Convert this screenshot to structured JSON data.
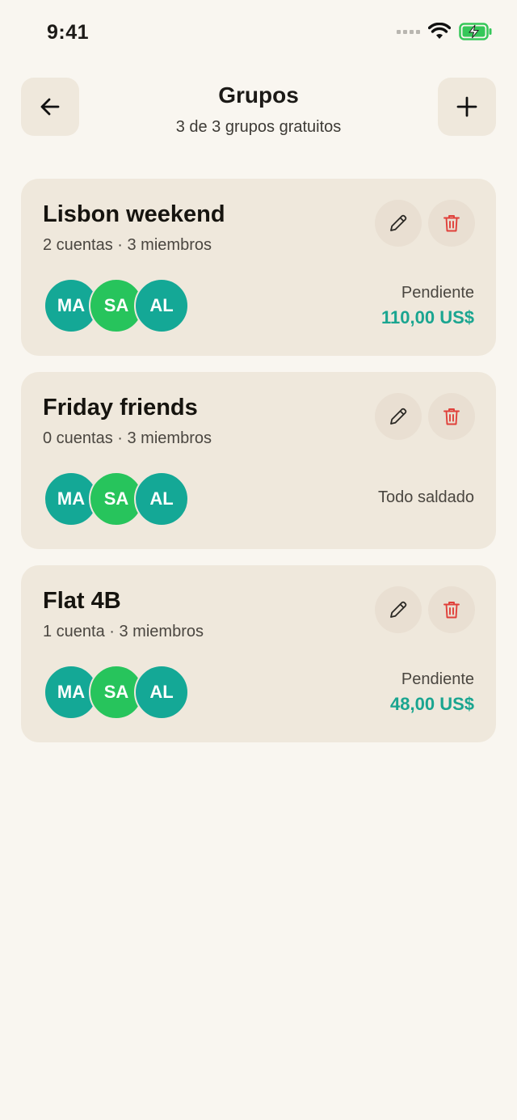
{
  "status_bar": {
    "time": "9:41"
  },
  "header": {
    "title": "Grupos",
    "subtitle": "3 de 3 grupos gratuitos"
  },
  "colors": {
    "background": "#f9f6f0",
    "card": "#efe8dc",
    "accent_teal": "#1aa590",
    "avatar_teal": "#14a896",
    "avatar_green": "#27c45c",
    "delete_red": "#e0403a",
    "battery_green": "#35c759"
  },
  "icons": {
    "back": "arrow-left-icon",
    "add": "plus-icon",
    "edit": "pencil-icon",
    "delete": "trash-icon",
    "wifi": "wifi-icon",
    "battery": "battery-charging-icon"
  },
  "groups": [
    {
      "name": "Lisbon weekend",
      "meta": "2 cuentas · 3 miembros",
      "members": [
        {
          "initials": "MA",
          "color": "#14a896"
        },
        {
          "initials": "SA",
          "color": "#27c45c"
        },
        {
          "initials": "AL",
          "color": "#14a896"
        }
      ],
      "balance_label": "Pendiente",
      "balance_amount": "110,00 US$"
    },
    {
      "name": "Friday friends",
      "meta": "0 cuentas · 3 miembros",
      "members": [
        {
          "initials": "MA",
          "color": "#14a896"
        },
        {
          "initials": "SA",
          "color": "#27c45c"
        },
        {
          "initials": "AL",
          "color": "#14a896"
        }
      ],
      "balance_label": "Todo saldado"
    },
    {
      "name": "Flat 4B",
      "meta": "1 cuenta · 3 miembros",
      "members": [
        {
          "initials": "MA",
          "color": "#14a896"
        },
        {
          "initials": "SA",
          "color": "#27c45c"
        },
        {
          "initials": "AL",
          "color": "#14a896"
        }
      ],
      "balance_label": "Pendiente",
      "balance_amount": "48,00 US$"
    }
  ]
}
